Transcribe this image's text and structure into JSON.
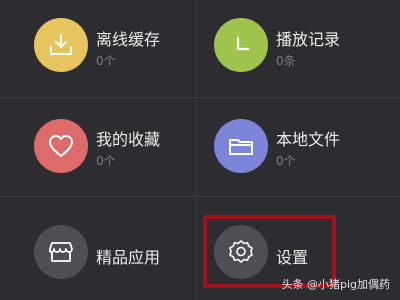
{
  "menu": {
    "items": [
      {
        "label": "离线缓存",
        "sub": "0个",
        "icon": "download-icon",
        "color": "#e6c45e"
      },
      {
        "label": "播放记录",
        "sub": "0条",
        "icon": "clock-icon",
        "color": "#9ec44e"
      },
      {
        "label": "我的收藏",
        "sub": "0个",
        "icon": "heart-icon",
        "color": "#de6b6b"
      },
      {
        "label": "本地文件",
        "sub": "0个",
        "icon": "folder-icon",
        "color": "#7c85d8"
      },
      {
        "label": "精品应用",
        "icon": "store-icon",
        "color": "#4e4e55"
      },
      {
        "label": "设置",
        "icon": "gear-icon",
        "color": "#4e4e55"
      }
    ]
  },
  "highlight_color": "#a4111b",
  "watermark": "头条 @小猪pig加偶药"
}
